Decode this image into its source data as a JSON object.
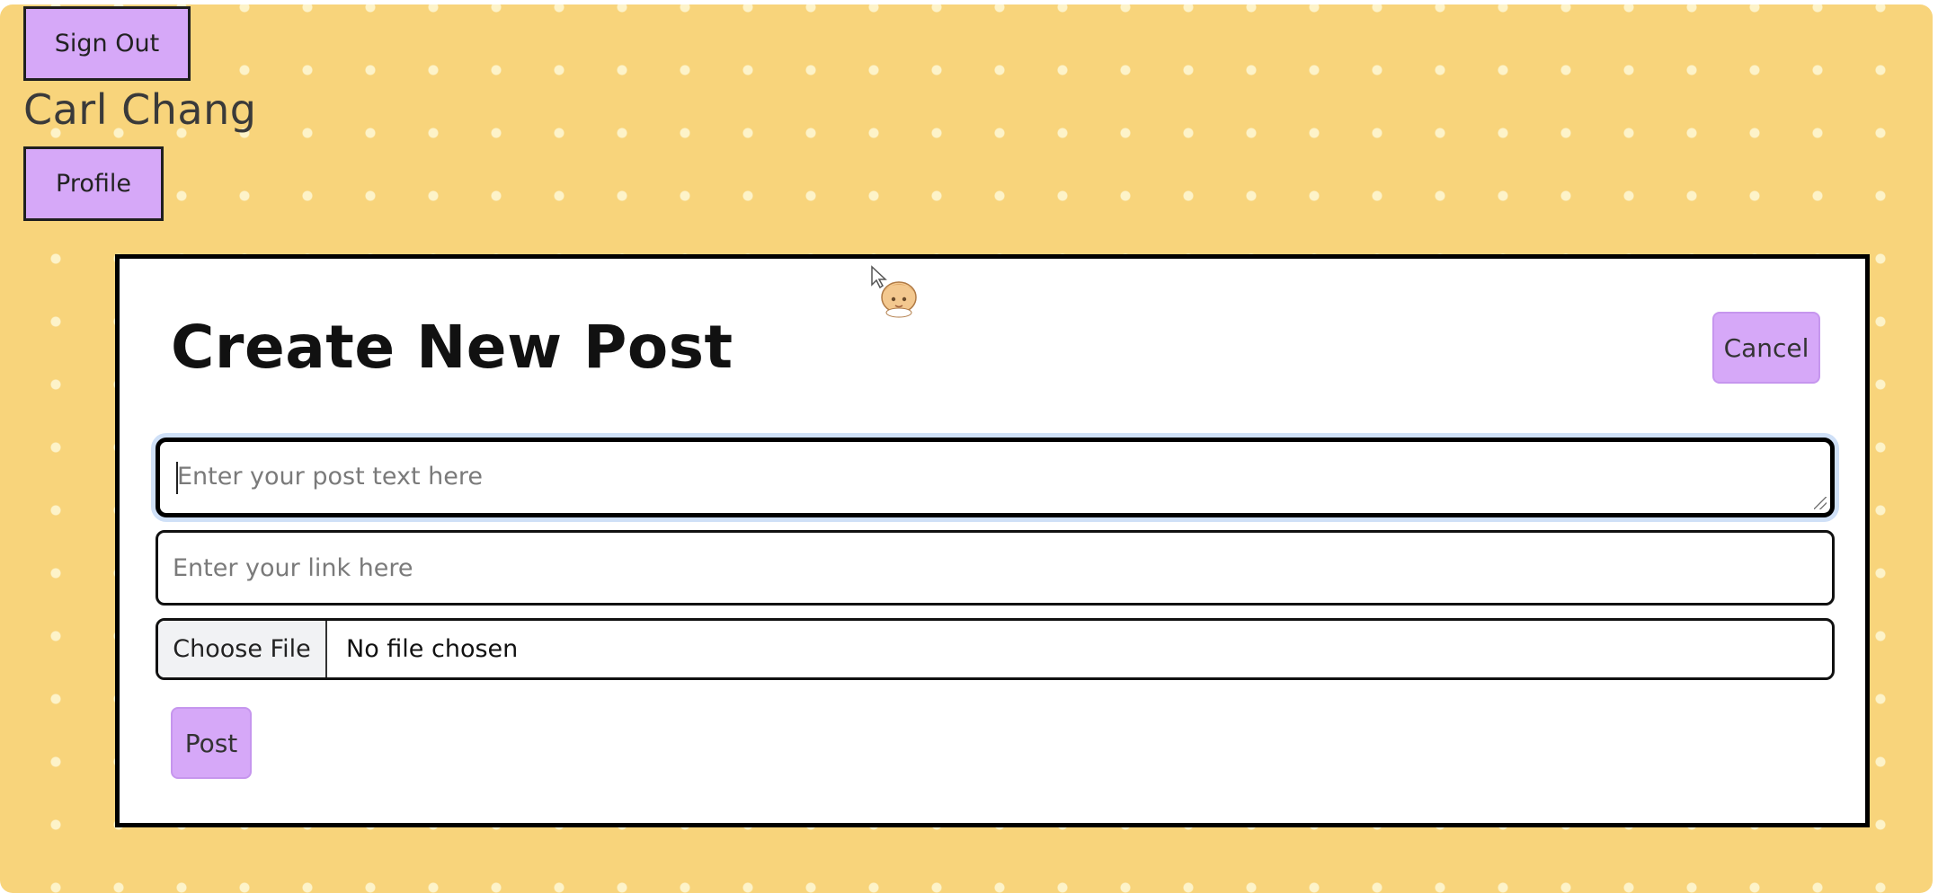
{
  "header": {
    "sign_out_label": "Sign Out",
    "user_name": "Carl Chang",
    "profile_label": "Profile"
  },
  "create_post": {
    "title": "Create New Post",
    "cancel_label": "Cancel",
    "text_placeholder": "Enter your post text here",
    "link_placeholder": "Enter your link here",
    "choose_file_label": "Choose File",
    "file_status": "No file chosen",
    "post_label": "Post"
  },
  "colors": {
    "background": "#f8d47b",
    "polka_dot": "#fdf3c9",
    "button": "#d6a8f8",
    "card": "#ffffff",
    "focus_ring": "#cfe0f7"
  },
  "icons": {
    "cursor": "anime-cursor-icon",
    "resize": "resize-grip-icon"
  }
}
